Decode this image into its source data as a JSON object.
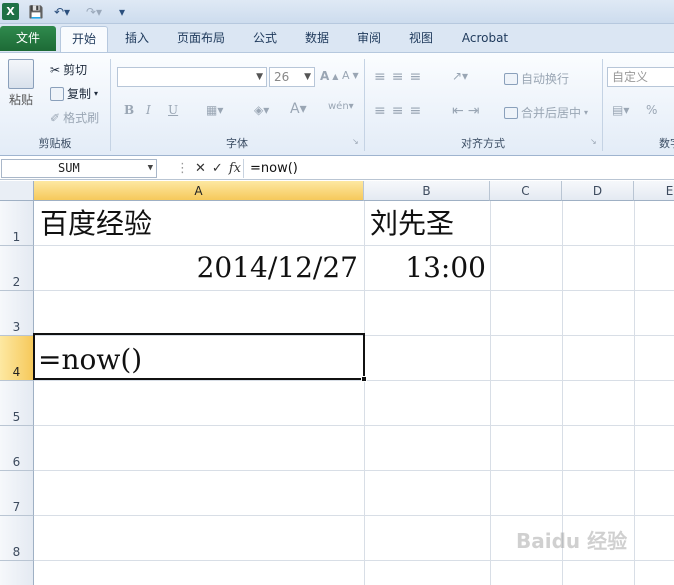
{
  "app": {
    "logo_text": "X"
  },
  "tabs": [
    "文件",
    "开始",
    "插入",
    "页面布局",
    "公式",
    "数据",
    "审阅",
    "视图",
    "Acrobat"
  ],
  "ribbon": {
    "clipboard": {
      "paste": "粘贴",
      "cut": "剪切",
      "copy": "复制",
      "format_painter": "格式刷",
      "label": "剪贴板"
    },
    "font": {
      "size": "26",
      "bold": "B",
      "italic": "I",
      "underline": "U",
      "grow": "A",
      "shrink": "A",
      "label": "字体"
    },
    "alignment": {
      "wrap": "自动换行",
      "merge": "合并后居中",
      "label": "对齐方式"
    },
    "number": {
      "format": "自定义",
      "percent": "%",
      "label": "数字"
    }
  },
  "formula_bar": {
    "name_box": "SUM",
    "fx": "fx",
    "cancel": "✕",
    "enter": "✓",
    "content": "=now()"
  },
  "grid": {
    "columns": [
      "A",
      "B",
      "C",
      "D",
      "E"
    ],
    "rows": [
      "1",
      "2",
      "3",
      "4",
      "5",
      "6",
      "7",
      "8"
    ],
    "selected_column": "A",
    "selected_row": "4",
    "cells": {
      "A1": "百度经验",
      "B1": "刘先圣",
      "A2": "2014/12/27",
      "B2": "13:00",
      "A4": "=now()"
    }
  },
  "watermark": "Baidu 经验"
}
